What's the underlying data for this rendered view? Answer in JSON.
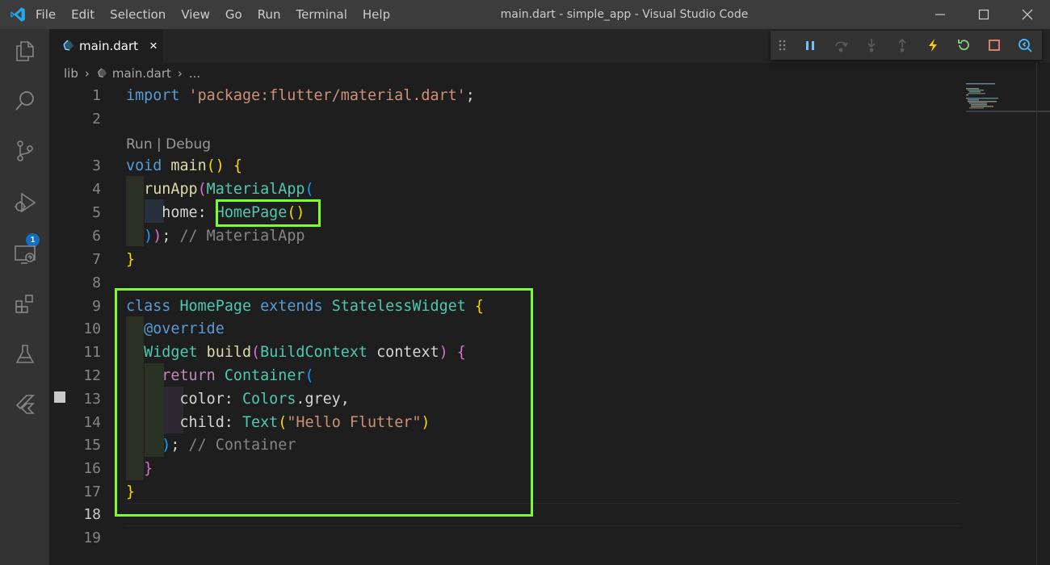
{
  "window": {
    "title": "main.dart - simple_app - Visual Studio Code",
    "menu": [
      "File",
      "Edit",
      "Selection",
      "View",
      "Go",
      "Run",
      "Terminal",
      "Help"
    ]
  },
  "activity_bar": {
    "items": [
      "explorer-icon",
      "search-icon",
      "source-control-icon",
      "run-debug-icon",
      "remote-explorer-icon",
      "extensions-icon",
      "testing-icon",
      "flutter-icon"
    ],
    "debug_badge": "1"
  },
  "tab": {
    "label": "main.dart",
    "close": "×"
  },
  "debug_toolbar": {
    "buttons": [
      "pause-icon",
      "step-over-icon",
      "step-into-icon",
      "step-out-icon",
      "hot-reload-icon",
      "hot-restart-icon",
      "stop-icon",
      "inspector-icon"
    ]
  },
  "breadcrumb": {
    "folder": "lib",
    "file": "main.dart",
    "more": "..."
  },
  "editor": {
    "codelens": "Run | Debug",
    "line_numbers": [
      "1",
      "2",
      "3",
      "4",
      "5",
      "6",
      "7",
      "8",
      "9",
      "10",
      "11",
      "12",
      "13",
      "14",
      "15",
      "16",
      "17",
      "18",
      "19"
    ],
    "active_line": "18",
    "lines": [
      "import 'package:flutter/material.dart';",
      "",
      "void main() {",
      "  runApp(MaterialApp(",
      "    home: HomePage()",
      "  )); // MaterialApp",
      "}",
      "",
      "class HomePage extends StatelessWidget {",
      "  @override",
      "  Widget build(BuildContext context) {",
      "    return Container(",
      "      color: Colors.grey,",
      "      child: Text(\"Hello Flutter\")",
      "    ); // Container",
      "  }",
      "}",
      "",
      ""
    ]
  },
  "colors": {
    "highlight": "#7fff1f",
    "accent": "#0e70c0",
    "debug_pause": "#75beff",
    "debug_hot_reload": "#ffcc00",
    "debug_restart": "#89d185",
    "debug_stop": "#f48771"
  }
}
